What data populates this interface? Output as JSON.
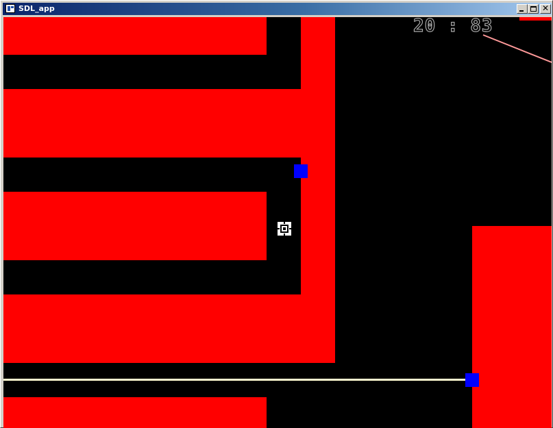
{
  "window": {
    "title": "SDL_app",
    "icon": "app-window-icon",
    "controls": {
      "minimize_icon": "minimize-icon",
      "maximize_icon": "maximize-icon",
      "close_glyph": "✕"
    }
  },
  "game": {
    "background_color": "#000000",
    "wall_color": "#ff0000",
    "enemy_color": "#0000ff",
    "laser_color": "#fffbd0",
    "beam_color": "#ff9a9a",
    "score": {
      "left": "20",
      "separator": ":",
      "right": "83",
      "text": "20 : 83"
    },
    "enemies_count": 2
  }
}
